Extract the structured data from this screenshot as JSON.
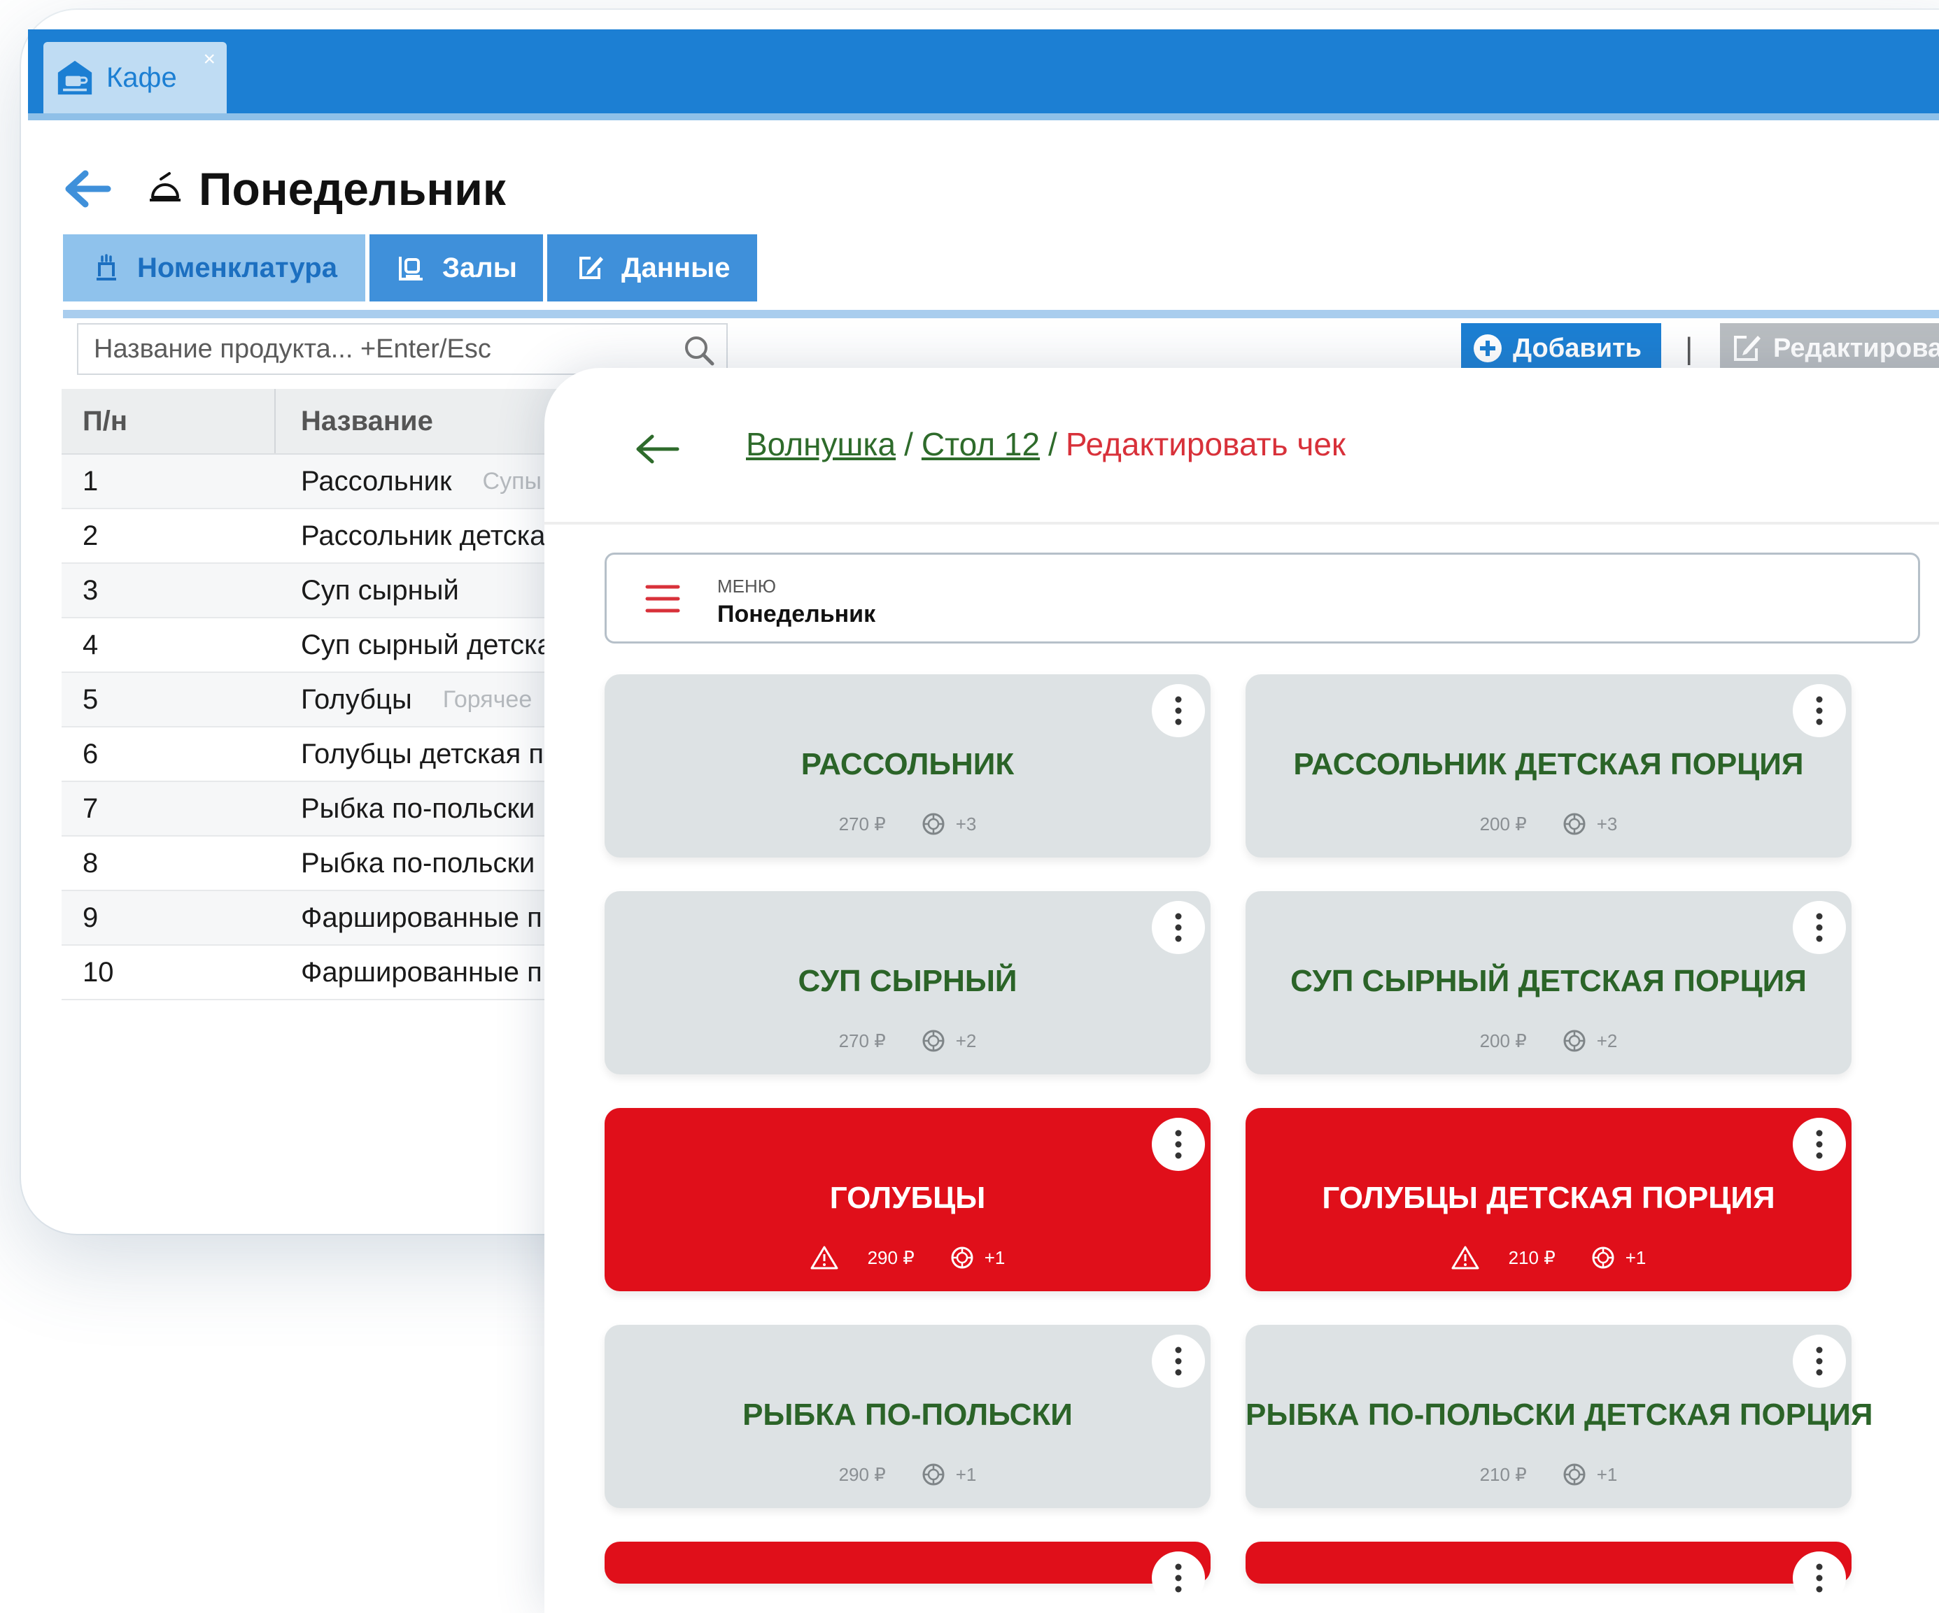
{
  "app": {
    "tab_label": "Кафе",
    "close_glyph": "×"
  },
  "page": {
    "title": "Понедельник"
  },
  "tabs": [
    {
      "label": "Номенклатура",
      "icon": "nomenclature-icon"
    },
    {
      "label": "Залы",
      "icon": "halls-icon"
    },
    {
      "label": "Данные",
      "icon": "edit-data-icon"
    }
  ],
  "search": {
    "placeholder": "Название продукта... +Enter/Esc"
  },
  "toolbar": {
    "add_label": "Добавить",
    "separator": "|",
    "edit_label": "Редактирова"
  },
  "table": {
    "headers": [
      "П/н",
      "Название"
    ],
    "rows": [
      {
        "num": "1",
        "name": "Рассольник",
        "category": "Супы"
      },
      {
        "num": "2",
        "name": "Рассольник детска",
        "category": ""
      },
      {
        "num": "3",
        "name": "Суп сырный",
        "category": ""
      },
      {
        "num": "4",
        "name": "Суп сырный детска",
        "category": ""
      },
      {
        "num": "5",
        "name": "Голубцы",
        "category": "Горячее"
      },
      {
        "num": "6",
        "name": "Голубцы детская п",
        "category": ""
      },
      {
        "num": "7",
        "name": "Рыбка по-польски",
        "category": ""
      },
      {
        "num": "8",
        "name": "Рыбка по-польски ,",
        "category": ""
      },
      {
        "num": "9",
        "name": "Фаршированные п",
        "category": ""
      },
      {
        "num": "10",
        "name": "Фаршированные п",
        "category": ""
      }
    ]
  },
  "breadcrumb": {
    "items": [
      "Волнушка",
      "Стол 12"
    ],
    "separator": "/",
    "current": "Редактировать чек"
  },
  "menu_selector": {
    "label": "МЕНЮ",
    "value": "Понедельник"
  },
  "cards": [
    {
      "name": "РАССОЛЬНИК",
      "price": "270 ₽",
      "extras": "+3",
      "style": "normal"
    },
    {
      "name": "РАССОЛЬНИК ДЕТСКАЯ ПОРЦИЯ",
      "price": "200 ₽",
      "extras": "+3",
      "style": "normal"
    },
    {
      "name": "СУП СЫРНЫЙ",
      "price": "270 ₽",
      "extras": "+2",
      "style": "normal"
    },
    {
      "name": "СУП СЫРНЫЙ ДЕТСКАЯ ПОРЦИЯ",
      "price": "200 ₽",
      "extras": "+2",
      "style": "normal"
    },
    {
      "name": "ГОЛУБЦЫ",
      "price": "290 ₽",
      "extras": "+1",
      "style": "alert"
    },
    {
      "name": "ГОЛУБЦЫ ДЕТСКАЯ ПОРЦИЯ",
      "price": "210 ₽",
      "extras": "+1",
      "style": "alert"
    },
    {
      "name": "РЫБКА ПО-ПОЛЬСКИ",
      "price": "290 ₽",
      "extras": "+1",
      "style": "normal"
    },
    {
      "name": "РЫБКА ПО-ПОЛЬСКИ ДЕТСКАЯ ПОРЦИЯ",
      "price": "210 ₽",
      "extras": "+1",
      "style": "normal"
    }
  ],
  "colors": {
    "accent_blue": "#1c7fd3",
    "card_grey": "#dde2e4",
    "alert_red": "#e00f1a",
    "dish_green": "#2b6428",
    "breadcrumb_current": "#d8313a"
  }
}
